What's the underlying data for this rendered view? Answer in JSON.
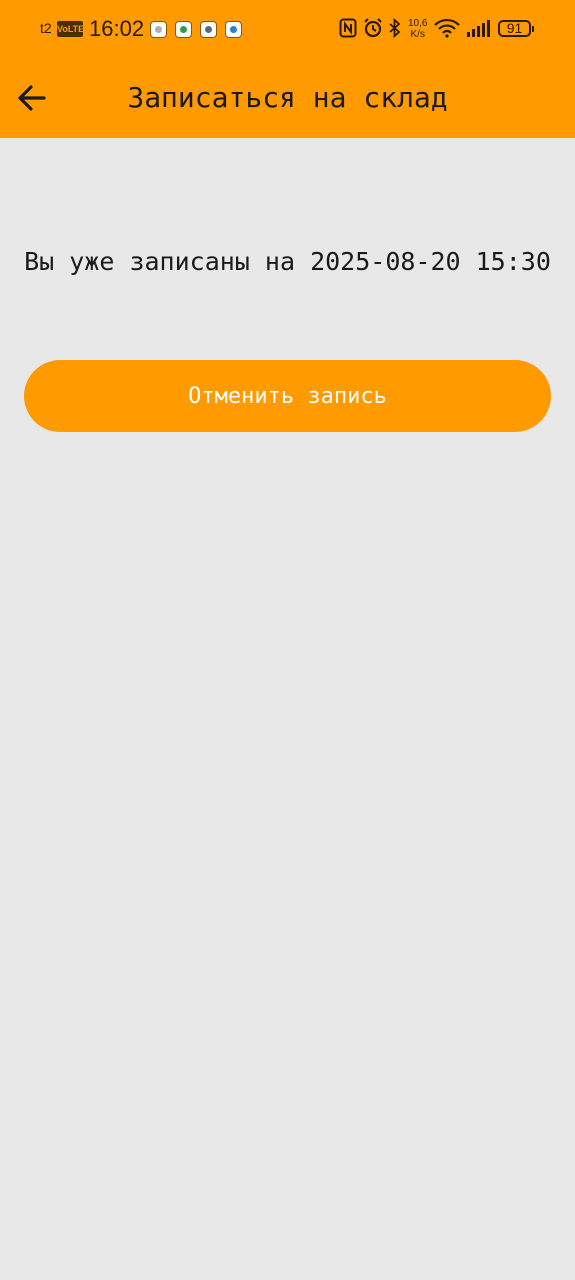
{
  "status_bar": {
    "carrier": "t2",
    "volte": "VoLTE",
    "time": "16:02",
    "network_speed_value": "10,6",
    "network_speed_unit": "K/s",
    "battery": "91",
    "app_icons": [
      "settings-app-icon",
      "whatsapp-app-icon",
      "bus-app-icon",
      "messenger-app-icon"
    ]
  },
  "toolbar": {
    "title": "Записаться на склад"
  },
  "main": {
    "message": "Вы уже записаны на 2025-08-20 15:30",
    "cancel_label": "Отменить запись"
  },
  "colors": {
    "accent": "#ff9b00",
    "background": "#e8e8e8",
    "text": "#1a1a1a",
    "button_text": "#ffffff"
  }
}
